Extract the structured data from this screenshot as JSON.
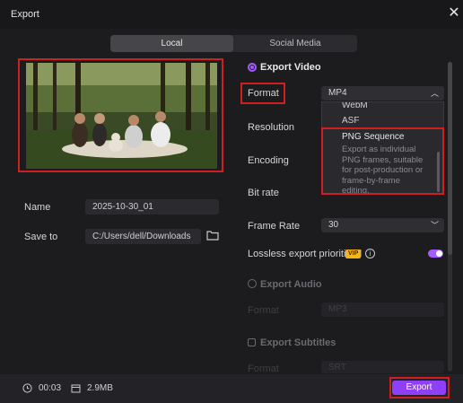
{
  "window": {
    "title": "Export"
  },
  "tabs": [
    {
      "label": "Local",
      "active": true
    },
    {
      "label": "Social Media",
      "active": false
    }
  ],
  "left": {
    "name_label": "Name",
    "name_value": "2025-10-30_01",
    "save_label": "Save to",
    "save_value": "C:/Users/dell/Downloads"
  },
  "right": {
    "export_video_label": "Export Video",
    "format_label": "Format",
    "format_value": "MP4",
    "resolution_label": "Resolution",
    "encoding_label": "Encoding",
    "bitrate_label": "Bit rate",
    "framerate_label": "Frame Rate",
    "framerate_value": "30",
    "lossless_label": "Lossless export prioritized",
    "vip_badge": "VIP",
    "export_audio_label": "Export Audio",
    "audio_format_label": "Format",
    "audio_format_value": "MP3",
    "export_subtitles_label": "Export Subtitles",
    "subtitle_format_label": "Format",
    "subtitle_format_value": "SRT"
  },
  "dropdown": {
    "items": [
      "WebM",
      "ASF",
      "PNG Sequence"
    ],
    "png_description": "Export as individual PNG frames, suitable for post-production or frame-by-frame editing."
  },
  "footer": {
    "duration": "00:03",
    "size": "2.9MB",
    "export_label": "Export"
  },
  "colors": {
    "accent": "#8f3ff7",
    "highlight": "#d01f22",
    "vip": "#f4b515"
  }
}
